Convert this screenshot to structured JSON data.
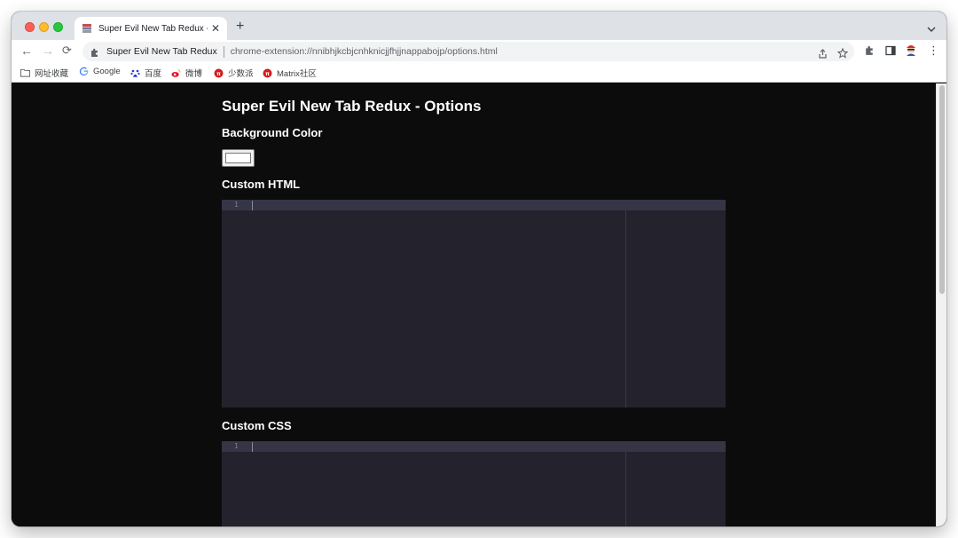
{
  "browser": {
    "tab_title": "Super Evil New Tab Redux - Op",
    "tab_close": "✕",
    "new_tab": "+",
    "tab_menu": "⌄",
    "back": "←",
    "forward": "→",
    "reload": "⟳",
    "site_name": "Super Evil New Tab Redux",
    "url": "chrome-extension://nnibhjkcbjcnhknicjjfhjjnappabojp/options.html",
    "more_menu": "⋮"
  },
  "bookmarks": [
    {
      "label": "网址收藏",
      "icon": "folder-icon"
    },
    {
      "label": "Google",
      "icon": "google-icon"
    },
    {
      "label": "百度",
      "icon": "baidu-icon"
    },
    {
      "label": "微博",
      "icon": "weibo-icon"
    },
    {
      "label": "少数派",
      "icon": "sspai-icon"
    },
    {
      "label": "Matrix社区",
      "icon": "sspai-icon"
    }
  ],
  "page": {
    "title": "Super Evil New Tab Redux - Options",
    "background_color_label": "Background Color",
    "background_color_value": "#ffffff",
    "custom_html_label": "Custom HTML",
    "custom_css_label": "Custom CSS",
    "html_editor": {
      "line_number": "1",
      "content": ""
    },
    "css_editor": {
      "line_number": "1",
      "content": ""
    }
  },
  "colors": {
    "page_background": "#0c0c0c",
    "editor_background": "#23222d",
    "editor_active_line": "#363546",
    "tabstrip": "#dee1e6"
  }
}
